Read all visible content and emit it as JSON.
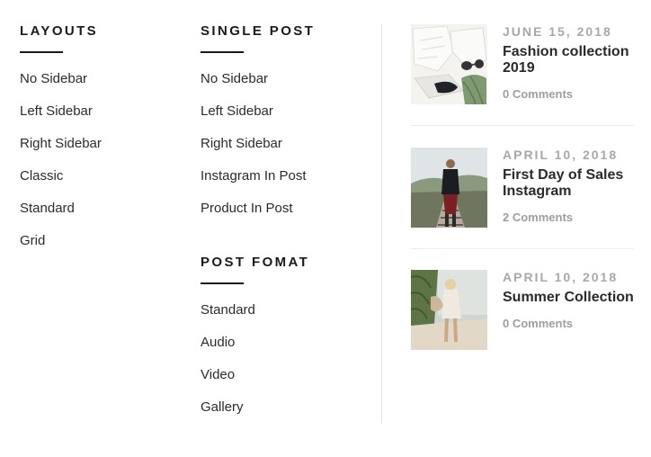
{
  "layouts": {
    "heading": "LAYOUTS",
    "items": [
      "No Sidebar",
      "Left Sidebar",
      "Right Sidebar",
      "Classic",
      "Standard",
      "Grid"
    ]
  },
  "single_post": {
    "heading": "SINGLE POST",
    "items": [
      "No Sidebar",
      "Left Sidebar",
      "Right Sidebar",
      "Instagram In Post",
      "Product In Post"
    ]
  },
  "post_format": {
    "heading": "POST FOMAT",
    "items": [
      "Standard",
      "Audio",
      "Video",
      "Gallery"
    ]
  },
  "recent_posts": [
    {
      "date": "JUNE 15, 2018",
      "title": "Fashion collection 2019",
      "comments": "0 Comments",
      "image": "flatlay-clothes-sunglasses-shoes"
    },
    {
      "date": "APRIL 10, 2018",
      "title": "First Day of Sales Instagram",
      "comments": "2 Comments",
      "image": "man-on-railway-track"
    },
    {
      "date": "APRIL 10, 2018",
      "title": "Summer Collection",
      "comments": "0 Comments",
      "image": "woman-on-beach"
    }
  ]
}
